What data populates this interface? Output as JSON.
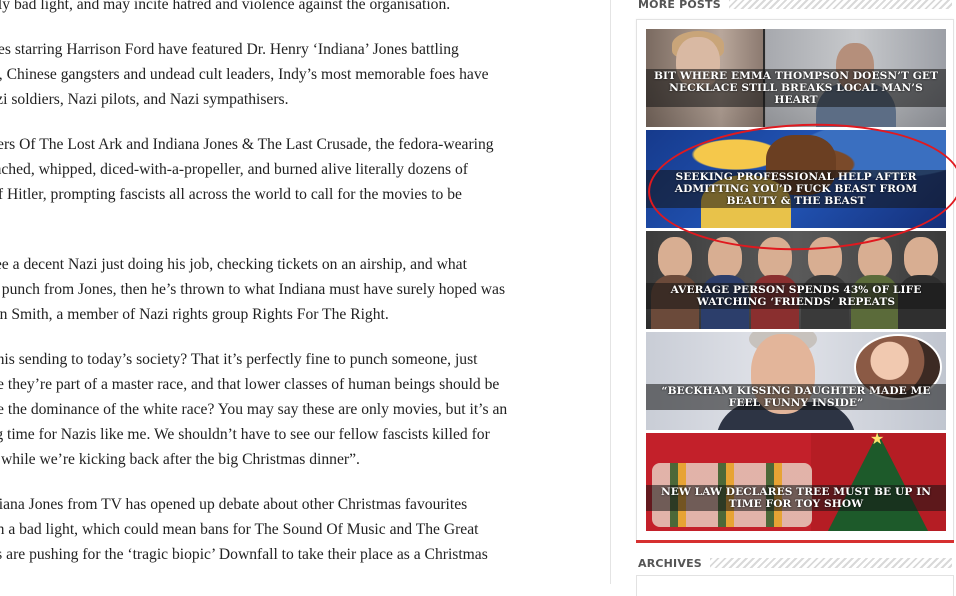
{
  "article": {
    "paragraphs": [
      [
        "dibly bad light, and may incite hatred and violence against the organisation."
      ],
      [
        "ovies starring Harrison Ford have featured Dr. Henry ‘Indiana’ Jones battling",
        "ens, Chinese gangsters and undead cult leaders, Indy’s most memorable foes have",
        "Nazi soldiers, Nazi pilots, and Nazi sympathisers."
      ],
      [
        "aiders Of The Lost Ark and Indiana Jones & The Last Crusade, the fedora-wearing",
        "punched, whipped, diced-with-a-propeller, and burned alive literally dozens of",
        "dolf Hitler, prompting fascists all across the world to call for the movies to be",
        ""
      ],
      [
        "e see a decent Nazi just doing his job, checking tickets on an airship, and what",
        "ker punch from Jones, then he’s thrown to what Indiana must have surely hoped was",
        "John Smith, a member of Nazi rights group Rights For The Right."
      ],
      [
        "is this sending to today’s society? That it’s perfectly fine to punch someone, just",
        "ieve they’re part of a master race, and that lower classes of human beings should be",
        "sure the dominance of the white race? You may say these are only movies, but it’s an",
        "ring time for Nazis like me. We shouldn’t have to see our fellow fascists killed for",
        "ent while we’re kicking back after the big Christmas dinner”."
      ],
      [
        "Indiana Jones from TV has opened up debate about other Christmas favourites",
        "is in a bad light, which could mean bans for The Sound Of Music and The Great",
        "azis are pushing for the ‘tragic biopic’ Downfall to take their place as a Christmas"
      ]
    ]
  },
  "sidebar": {
    "more_posts_title": "MORE POSTS",
    "archives_title": "ARCHIVES",
    "posts": [
      {
        "caption": "BIT WHERE EMMA THOMPSON DOESN’T GET NECKLACE STILL BREAKS LOCAL MAN’S HEART"
      },
      {
        "caption": "SEEKING PROFESSIONAL HELP AFTER ADMITTING YOU’D FUCK BEAST FROM BEAUTY & THE BEAST"
      },
      {
        "caption": "AVERAGE PERSON SPENDS 43% OF LIFE WATCHING ‘FRIENDS’ REPEATS"
      },
      {
        "caption": "“BECKHAM KISSING DAUGHTER MADE ME FEEL FUNNY INSIDE”"
      },
      {
        "caption": "NEW LAW DECLARES TREE MUST BE UP IN TIME FOR TOY SHOW"
      }
    ]
  },
  "colors": {
    "accent_red": "#d63030",
    "annotation_red": "#e0191f"
  }
}
